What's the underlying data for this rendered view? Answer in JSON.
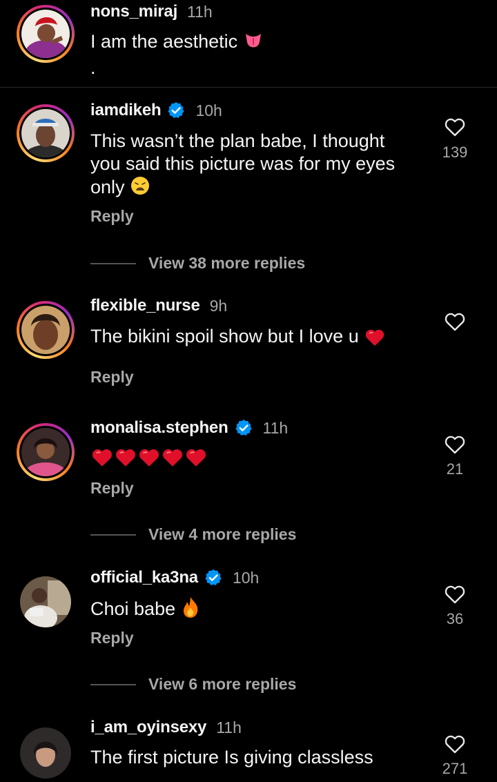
{
  "comments": [
    {
      "username": "nons_miraj",
      "time": "11h",
      "text": "I am the aesthetic",
      "extra": "."
    },
    {
      "username": "iamdikeh",
      "time": "10h",
      "text_lines": [
        "This wasn’t the plan babe, I thought",
        "you said this picture was for my eyes",
        "only"
      ],
      "likes": "139",
      "reply": "Reply",
      "view_replies": "View 38 more replies"
    },
    {
      "username": "flexible_nurse",
      "time": "9h",
      "text": "The bikini spoil show but I love u",
      "reply": "Reply"
    },
    {
      "username": "monalisa.stephen",
      "time": "11h",
      "likes": "21",
      "reply": "Reply",
      "view_replies": "View 4 more replies"
    },
    {
      "username": "official_ka3na",
      "time": "10h",
      "text": "Choi babe",
      "likes": "36",
      "reply": "Reply",
      "view_replies": "View 6 more replies"
    },
    {
      "username": "i_am_oyinsexy",
      "time": "11h",
      "text": "The first picture Is giving classless",
      "likes": "271"
    }
  ],
  "icons": {
    "like": "heart-outline-icon",
    "verified": "verified-badge-icon",
    "tongue": "tongue-emoji",
    "weary": "weary-face-emoji",
    "heart": "red-heart-emoji",
    "fire": "fire-emoji"
  },
  "colors": {
    "background": "#000000",
    "secondary_text": "#a8a8a8",
    "verified_blue": "#0095f6",
    "heart_red": "#e0102b"
  }
}
